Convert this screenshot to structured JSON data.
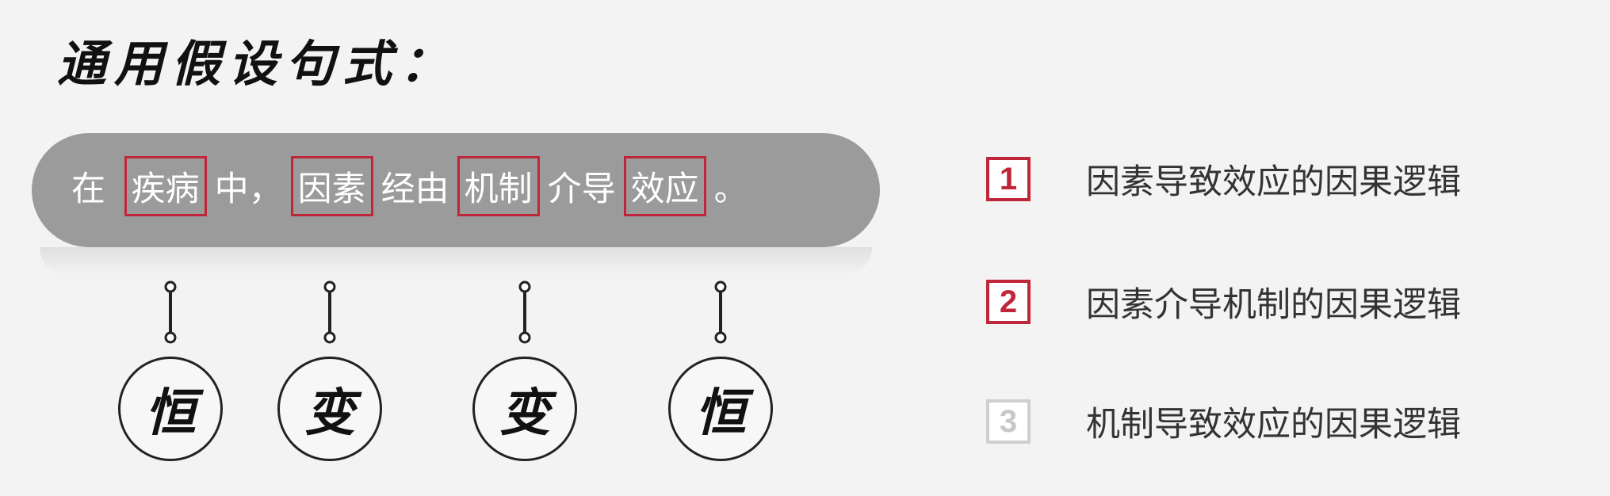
{
  "title": "通用假设句式：",
  "sentence": {
    "p1": "在 ",
    "w1": "疾病",
    "p2": "中，",
    "w2": "因素",
    "p3": "经由",
    "w3": "机制",
    "p4": "介导",
    "w4": "效应",
    "p5": "。"
  },
  "circles": [
    {
      "label": "恒"
    },
    {
      "label": "变"
    },
    {
      "label": "变"
    },
    {
      "label": "恒"
    }
  ],
  "logic_items": [
    {
      "num": "1",
      "text": "因素导致效应的因果逻辑"
    },
    {
      "num": "2",
      "text": "因素介导机制的因果逻辑"
    },
    {
      "num": "3",
      "text": "机制导致效应的因果逻辑"
    }
  ],
  "colors": {
    "accent": "#c0263a",
    "pill": "#9b9b9b",
    "muted": "#c8c8c8"
  }
}
